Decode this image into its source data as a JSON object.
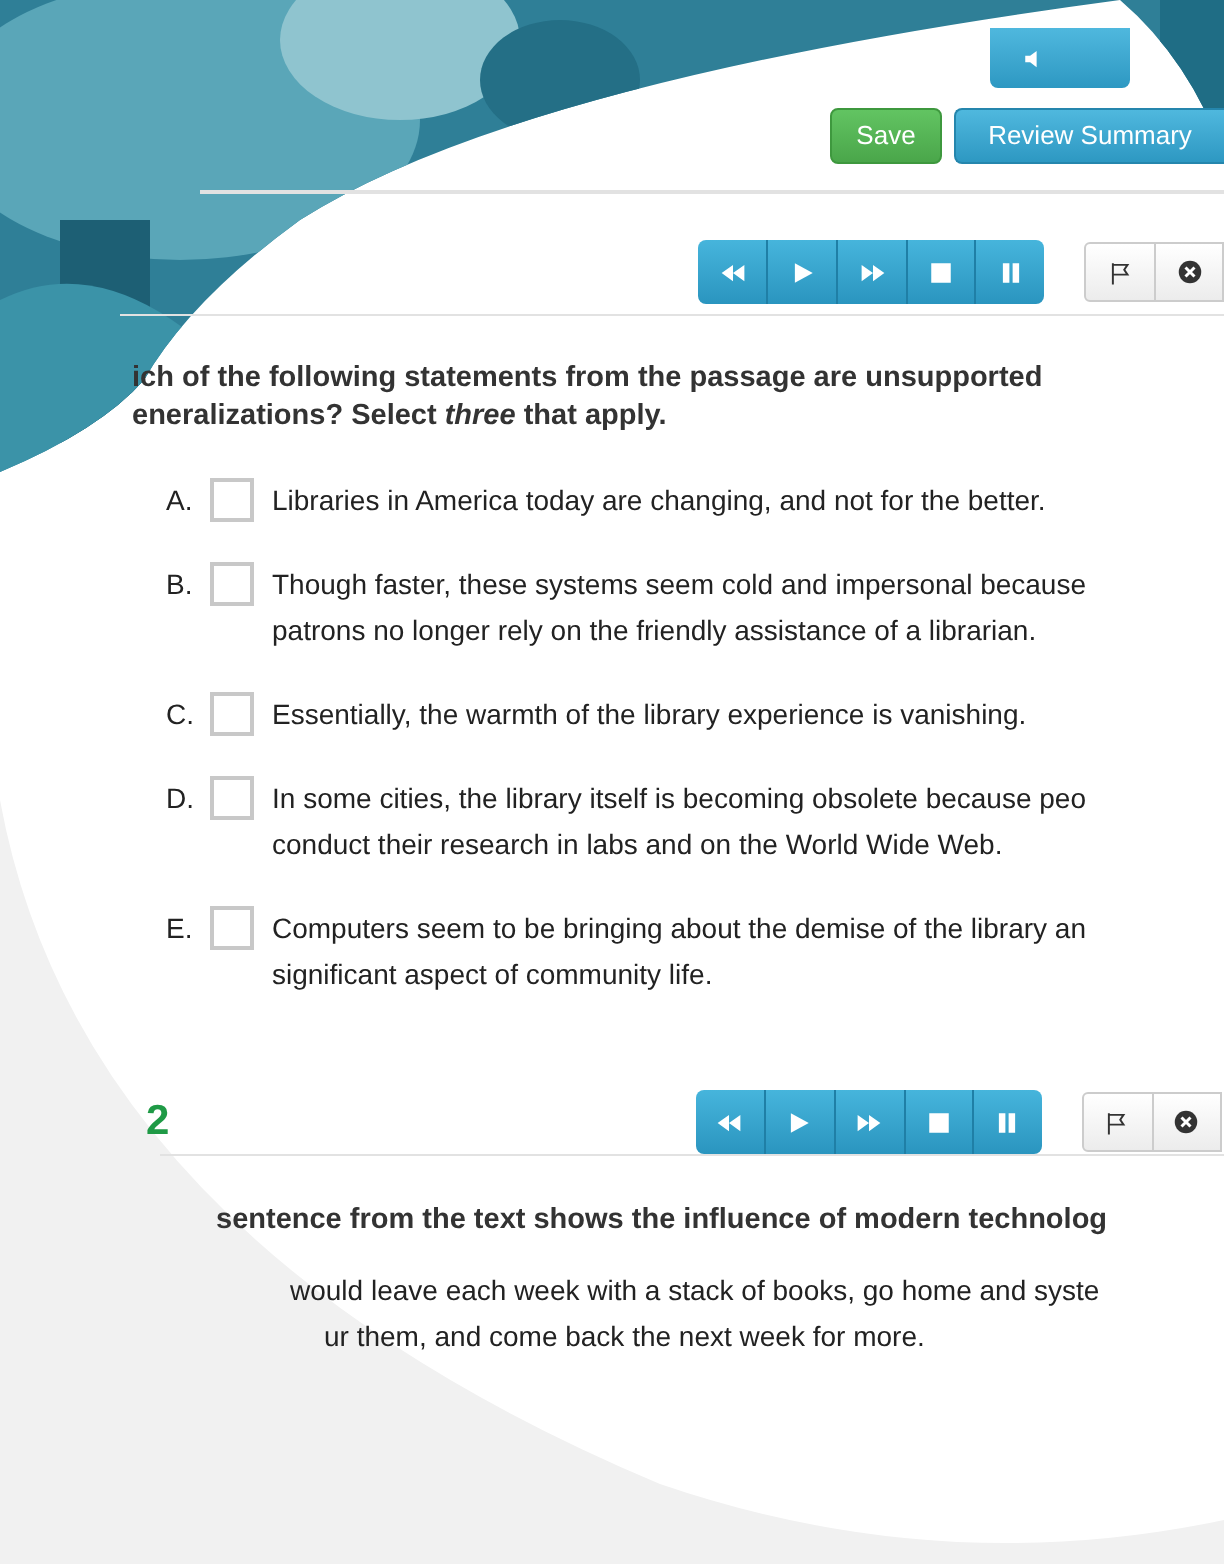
{
  "actions": [
    {
      "label": "Save",
      "kind": "save"
    },
    {
      "label": "Review Summary",
      "kind": "review"
    }
  ],
  "question_1": {
    "prompt": "ich of the following statements from the passage are unsupported\neneralizations?  Select *three* that apply.",
    "options": [
      {
        "letter": "A.",
        "lines": [
          "Libraries in America today are changing, and not for the better."
        ],
        "checked": false
      },
      {
        "letter": "B.",
        "lines": [
          "Though faster, these systems seem cold and impersonal because",
          "patrons no longer rely on the friendly assistance of a librarian."
        ],
        "checked": false
      },
      {
        "letter": "C.",
        "lines": [
          "Essentially, the warmth of the library experience is vanishing."
        ],
        "checked": false
      },
      {
        "letter": "D.",
        "lines": [
          "In some cities, the library itself is becoming obsolete because peo",
          "conduct their research in labs and on the World Wide Web."
        ],
        "checked": false
      },
      {
        "letter": "E.",
        "lines": [
          "Computers seem to be bringing about the demise of the library an",
          "significant aspect of community life."
        ],
        "checked": false
      }
    ]
  },
  "question_2": {
    "number": "2",
    "prompt": "sentence from the text shows the influence of modern technolog",
    "quote": [
      "would leave each week with a stack of books, go home and syste",
      "ur them, and come back the next week for more."
    ]
  }
}
